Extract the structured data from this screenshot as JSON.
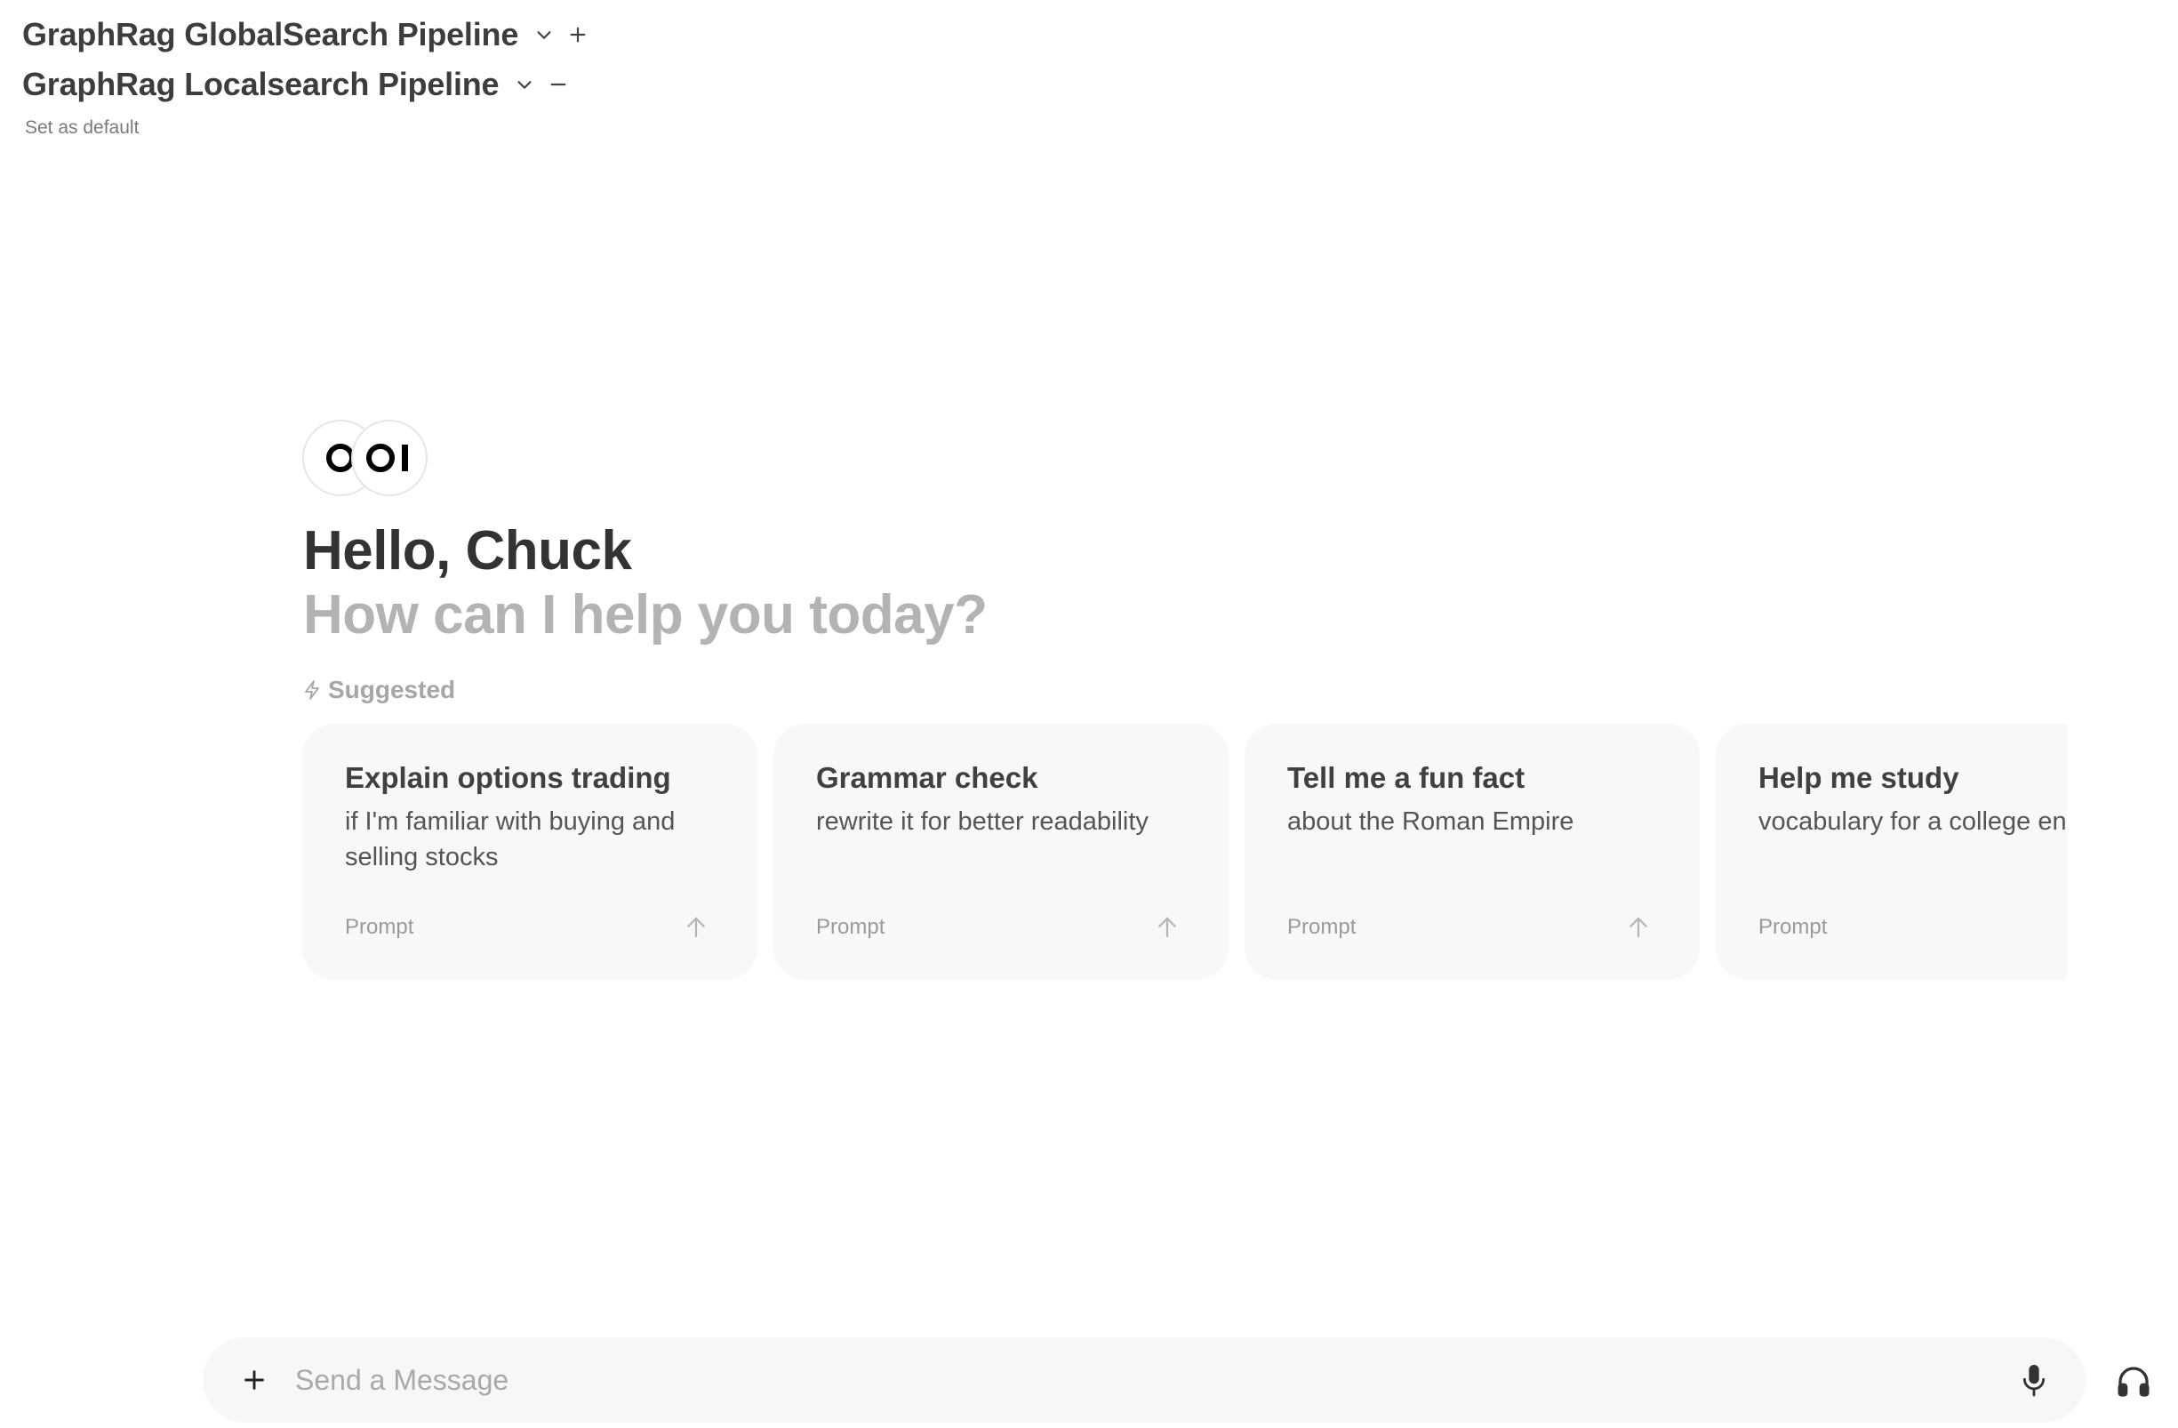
{
  "models": [
    {
      "name": "GraphRag GlobalSearch Pipeline",
      "dropdown_icon": "chevron-down-icon",
      "action_icon": "plus-icon"
    },
    {
      "name": "GraphRag Localsearch Pipeline",
      "dropdown_icon": "chevron-down-icon",
      "action_icon": "minus-icon"
    }
  ],
  "set_default_label": "Set as default",
  "logos": [
    "O",
    "OI"
  ],
  "greeting": {
    "hello": "Hello, Chuck",
    "subtitle": "How can I help you today?"
  },
  "suggested": {
    "label": "Suggested",
    "icon": "bolt-icon",
    "cards": [
      {
        "title": "Explain options trading",
        "description": "if I'm familiar with buying and selling stocks",
        "kind": "Prompt",
        "icon": "arrow-up-icon"
      },
      {
        "title": "Grammar check",
        "description": "rewrite it for better readability",
        "kind": "Prompt",
        "icon": "arrow-up-icon"
      },
      {
        "title": "Tell me a fun fact",
        "description": "about the Roman Empire",
        "kind": "Prompt",
        "icon": "arrow-up-icon"
      },
      {
        "title": "Help me study",
        "description": "vocabulary for a college entrance exam",
        "kind": "Prompt",
        "icon": "arrow-up-icon"
      }
    ]
  },
  "composer": {
    "placeholder": "Send a Message",
    "value": "",
    "add_icon": "plus-icon",
    "mic_icon": "microphone-icon",
    "call_icon": "headphones-icon"
  }
}
